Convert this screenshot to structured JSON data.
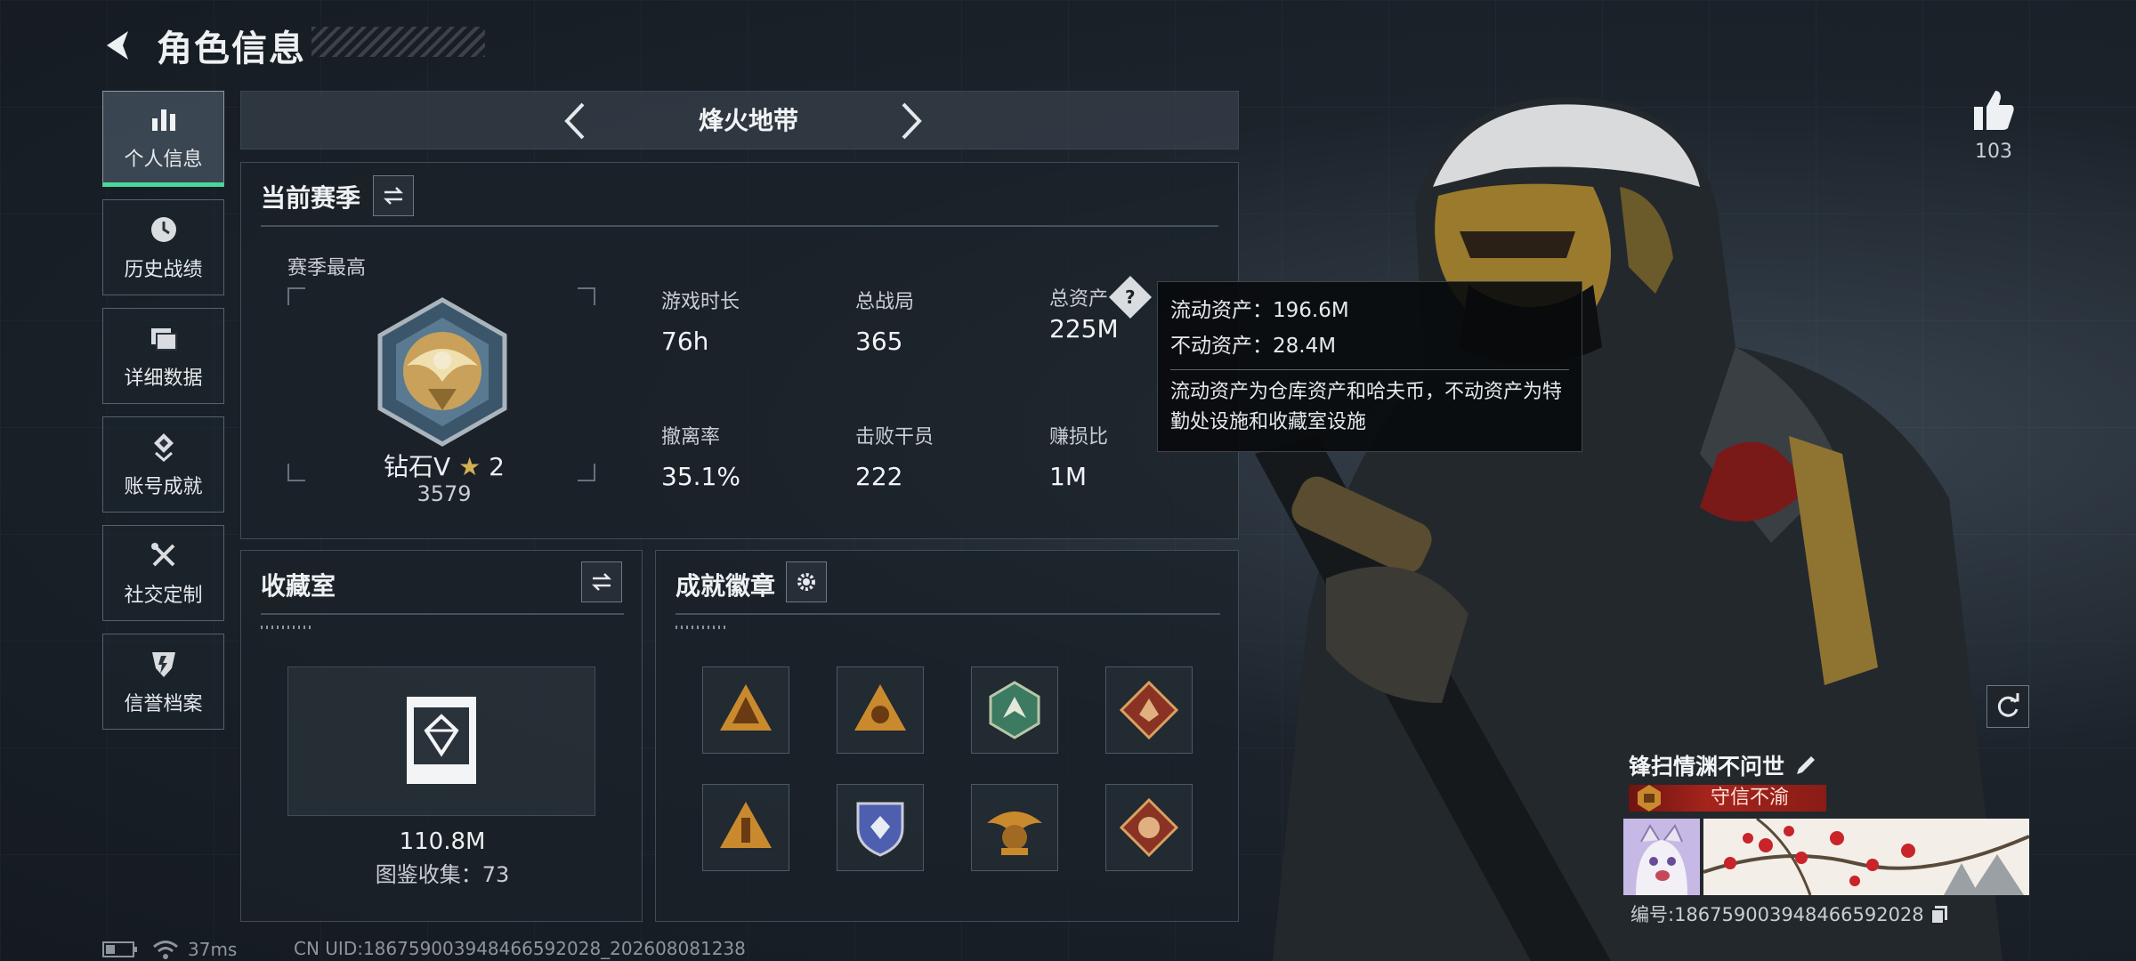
{
  "header": {
    "title": "角色信息"
  },
  "sidebar": {
    "items": [
      {
        "label": "个人信息",
        "icon": "bar-chart-icon",
        "active": true
      },
      {
        "label": "历史战绩",
        "icon": "history-clock-icon"
      },
      {
        "label": "详细数据",
        "icon": "folders-icon"
      },
      {
        "label": "账号成就",
        "icon": "achievement-icon"
      },
      {
        "label": "社交定制",
        "icon": "wrench-screwdriver-icon"
      },
      {
        "label": "信誉档案",
        "icon": "shield-badge-icon"
      }
    ]
  },
  "mode": {
    "title": "烽火地带"
  },
  "season": {
    "title": "当前赛季",
    "best_label": "赛季最高",
    "rank_name": "钻石V",
    "rank_stars": "★",
    "rank_level": "2",
    "rank_score": "3579",
    "stats": [
      {
        "label": "游戏时长",
        "value": "76h"
      },
      {
        "label": "总战局",
        "value": "365"
      },
      {
        "label": "总资产",
        "value": "225M",
        "help": "?"
      },
      {
        "label": "撤离率",
        "value": "35.1%"
      },
      {
        "label": "击败干员",
        "value": "222"
      },
      {
        "label": "赚损比",
        "value": "1M"
      }
    ]
  },
  "tooltip": {
    "liquid": "流动资产：196.6M",
    "fixed": "不动资产：28.4M",
    "description": "流动资产为仓库资产和哈夫币，不动资产为特勤处设施和收藏室设施"
  },
  "collection": {
    "title": "收藏室",
    "value": "110.8M",
    "count": "图鉴收集：73"
  },
  "badges": {
    "title": "成就徽章",
    "items": [
      {
        "icon": "triangle-badge-icon",
        "color": "#c98a2e"
      },
      {
        "icon": "triangle-eye-badge-icon",
        "color": "#c98a2e"
      },
      {
        "icon": "hexagon-wolf-badge-icon",
        "color": "#3c7a62"
      },
      {
        "icon": "diamond-dragon-badge-icon",
        "color": "#8a3324"
      },
      {
        "icon": "triangle-soldier-badge-icon",
        "color": "#c98a2e"
      },
      {
        "icon": "shield-gem-badge-icon",
        "color": "#4e5fb0"
      },
      {
        "icon": "eagle-crest-badge-icon",
        "color": "#c98a2e"
      },
      {
        "icon": "diamond-beast-badge-icon",
        "color": "#8a3324"
      }
    ]
  },
  "player": {
    "likes": "103",
    "name": "锋扫情渊不问世",
    "honor": "守信不渝",
    "id": "编号:1867590039484665920​28"
  },
  "status": {
    "ping": "37ms",
    "uid": "CN UID:1867590039484665920​28_202608081238"
  },
  "colors": {
    "accent": "#49d89a",
    "honor": "#a5241c",
    "gold": "#d3b054"
  }
}
